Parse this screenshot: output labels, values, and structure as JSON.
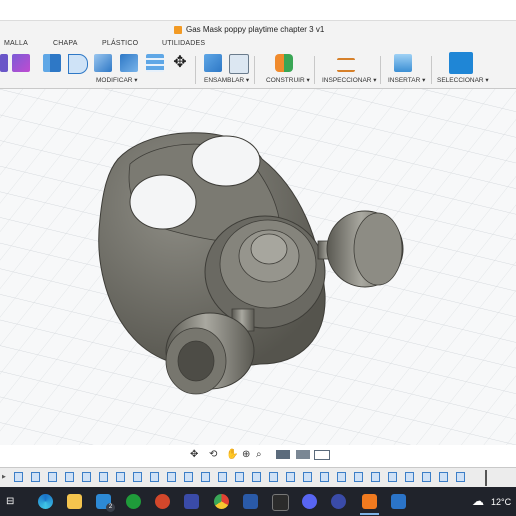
{
  "window": {
    "title": "Gas Mask poppy playtime chapter 3 v1"
  },
  "tabs": [
    {
      "label": "MALLA"
    },
    {
      "label": "CHAPA"
    },
    {
      "label": "PLÁSTICO"
    },
    {
      "label": "UTILIDADES"
    }
  ],
  "groups": {
    "modificar": "MODIFICAR ▾",
    "ensamblar": "ENSAMBLAR ▾",
    "construir": "CONSTRUIR ▾",
    "inspeccionar": "INSPECCIONAR ▾",
    "insertar": "INSERTAR ▾",
    "seleccionar": "SELECCIONAR ▾"
  },
  "taskbar": {
    "temperature": "12°C",
    "mail_badge": "2"
  },
  "colors": {
    "accent": "#1f86d6",
    "model": "#6f6e66",
    "taskbar": "#20232b"
  }
}
